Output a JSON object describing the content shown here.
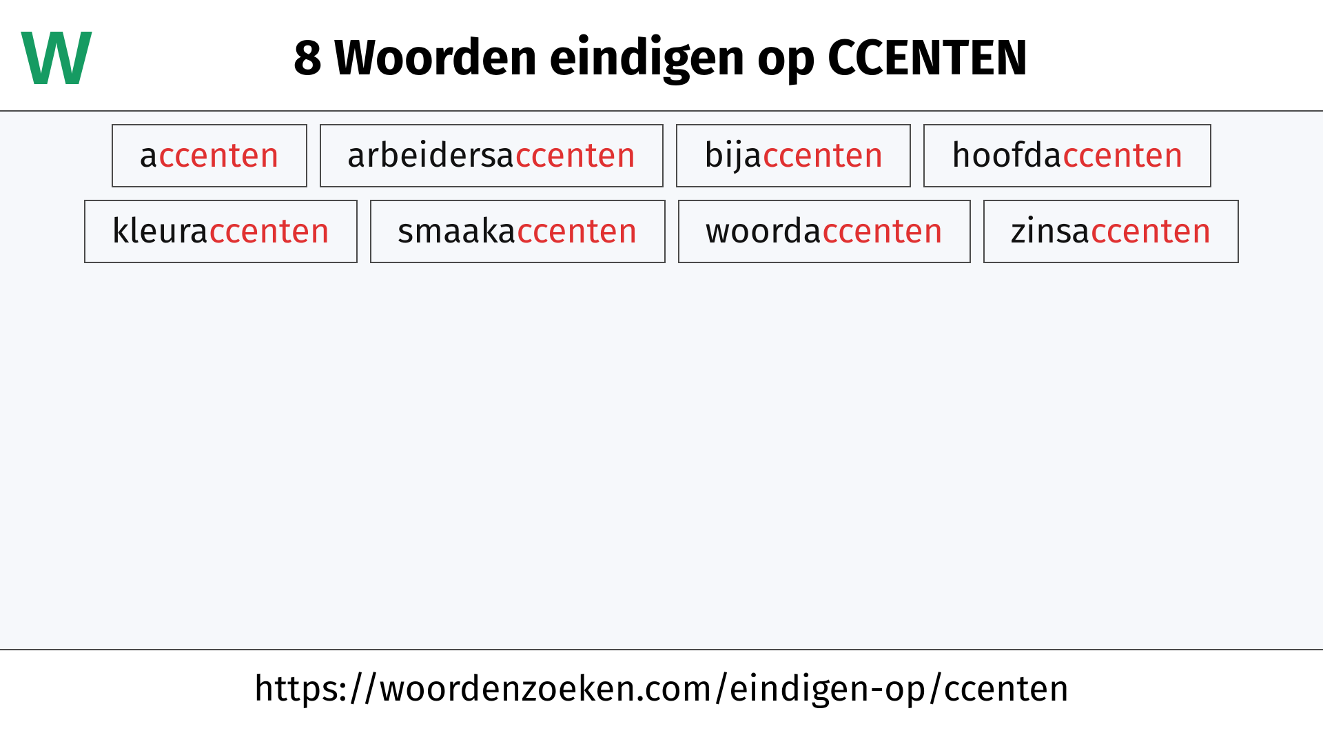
{
  "logo_letter": "W",
  "title": "8 Woorden eindigen op CCENTEN",
  "suffix": "ccenten",
  "words": [
    {
      "prefix": "a"
    },
    {
      "prefix": "arbeidersa"
    },
    {
      "prefix": "bija"
    },
    {
      "prefix": "hoofda"
    },
    {
      "prefix": "kleura"
    },
    {
      "prefix": "smaaka"
    },
    {
      "prefix": "woorda"
    },
    {
      "prefix": "zinsa"
    }
  ],
  "footer_url": "https://woordenzoeken.com/eindigen-op/ccenten",
  "colors": {
    "logo": "#169b62",
    "suffix": "#e03131",
    "border": "#4a4a4a",
    "content_bg": "#f6f8fb"
  }
}
